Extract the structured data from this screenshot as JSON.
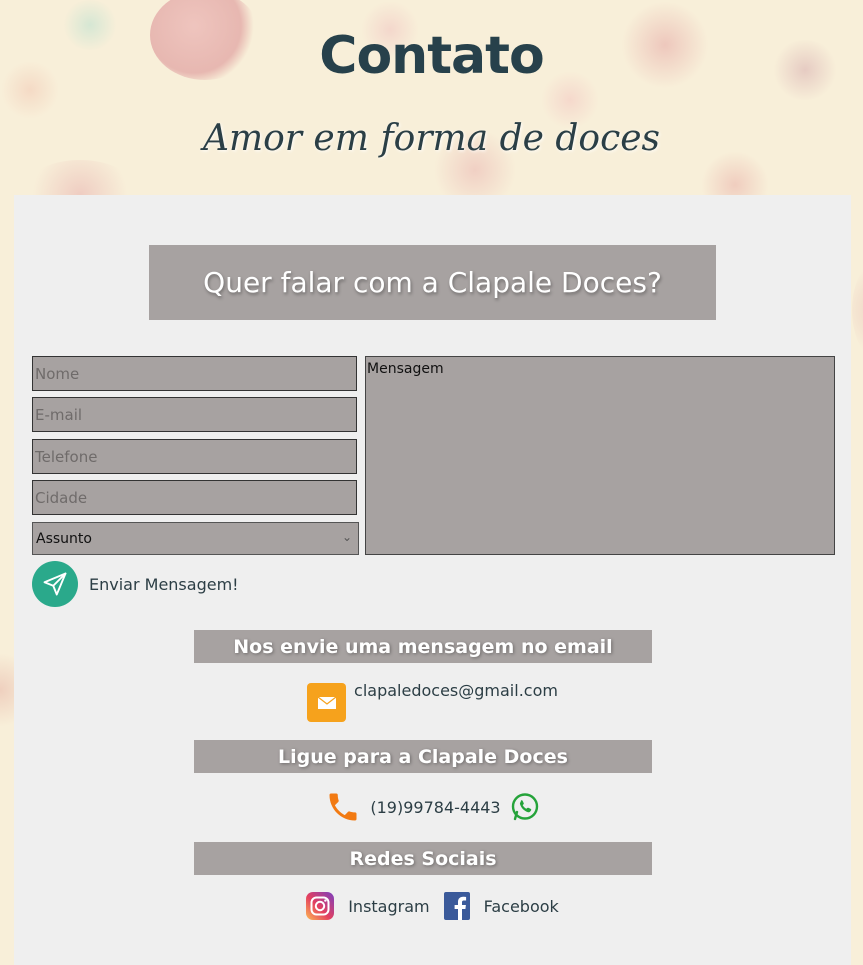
{
  "header": {
    "title": "Contato",
    "subtitle": "Amor em forma de doces"
  },
  "form": {
    "heading": "Quer falar com a Clapale Doces?",
    "name_placeholder": "Nome",
    "email_placeholder": "E-mail",
    "phone_placeholder": "Telefone",
    "city_placeholder": "Cidade",
    "subject_selected": "Assunto",
    "message_placeholder": "Mensagem",
    "send_label": "Enviar Mensagem!"
  },
  "email_section": {
    "heading": "Nos envie uma mensagem no email",
    "address": "clapaledoces@gmail.com"
  },
  "phone_section": {
    "heading": "Ligue para a Clapale Doces",
    "number": "(19)99784-4443"
  },
  "social_section": {
    "heading": "Redes Sociais",
    "instagram": "Instagram",
    "facebook": "Facebook"
  },
  "colors": {
    "panel": "#efefef",
    "bar": "#a7a2a1",
    "text_dark": "#27414b",
    "send_button": "#2aa98b",
    "email_icon": "#f6a21c",
    "phone_icon": "#f27a12",
    "whatsapp": "#25a33a",
    "facebook": "#3b5a9a"
  },
  "icons": [
    "paper-plane-icon",
    "envelope-icon",
    "phone-icon",
    "whatsapp-icon",
    "instagram-icon",
    "facebook-icon",
    "chevron-down-icon"
  ]
}
